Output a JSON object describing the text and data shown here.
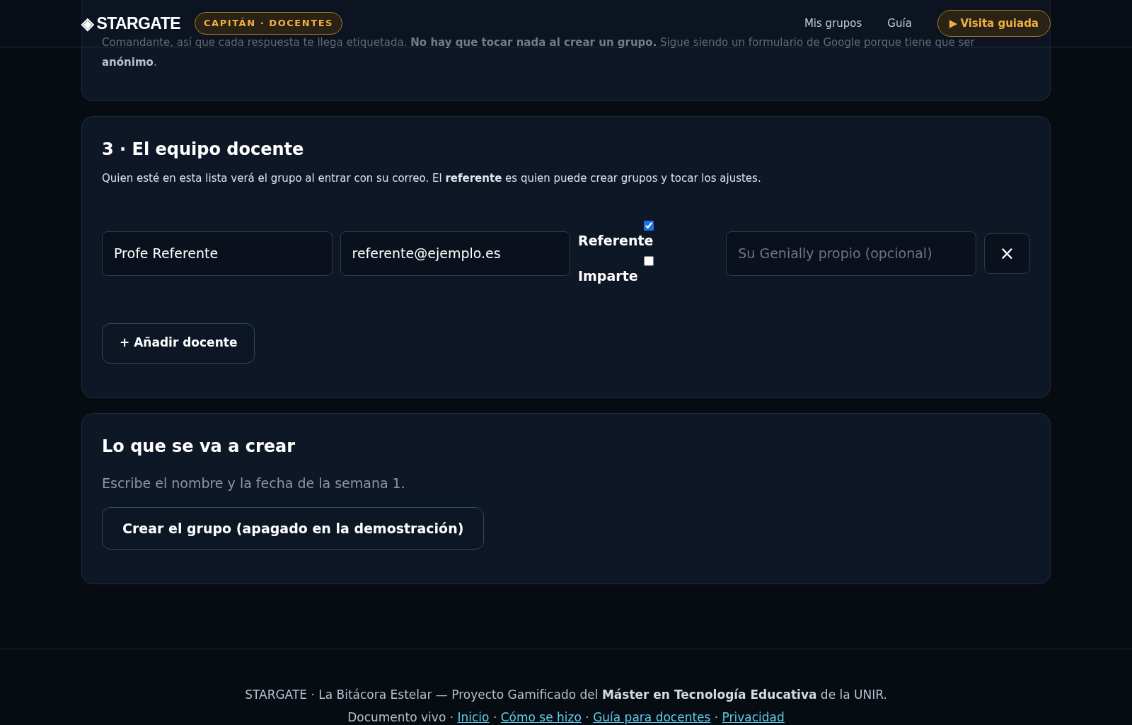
{
  "header": {
    "logo_mark": "◈",
    "logo": "STARGATE",
    "badge": "CAPITÁN · DOCENTES",
    "nav": [
      {
        "label": "Mis grupos"
      },
      {
        "label": "Guía"
      }
    ],
    "tour_button": {
      "icon": "▶",
      "label": "Visita guiada"
    }
  },
  "previous_section": {
    "text": "Comandante, así que cada respuesta te llega etiquetada. **No hay que tocar nada al crear un grupo.** Sigue siendo un formulario de Google porque tiene que ser **anónimo**."
  },
  "team_section": {
    "title": "3 · El equipo docente",
    "description": "Quien esté en esta lista verá el grupo al entrar con su correo. El **referente** es quien puede crear grupos y tocar los ajustes.",
    "teachers": [
      {
        "name": "Profe Referente",
        "email": "referente@ejemplo.es",
        "roles": [
          {
            "label": "Referente",
            "checked": true
          },
          {
            "label": "Imparte",
            "checked": false
          }
        ],
        "genially_placeholder": "Su Genially propio (opcional)",
        "remove": "×"
      }
    ],
    "add_button": "+ Añadir docente"
  },
  "create_section": {
    "title": "Lo que se va a crear",
    "hint": "Escribe el nombre y la fecha de la semana 1.",
    "create_button": {
      "label": "Crear el grupo (apagado en la demostración)"
    }
  },
  "footer": {
    "line": "STARGATE · La Bitácora Estelar — Proyecto Gamificado del **Máster en Tecnología Educativa** de la UNIR.",
    "prefix": "Documento vivo",
    "separator": "·",
    "links": [
      "Inicio",
      "Cómo se hizo",
      "Guía para docentes",
      "Privacidad"
    ]
  }
}
